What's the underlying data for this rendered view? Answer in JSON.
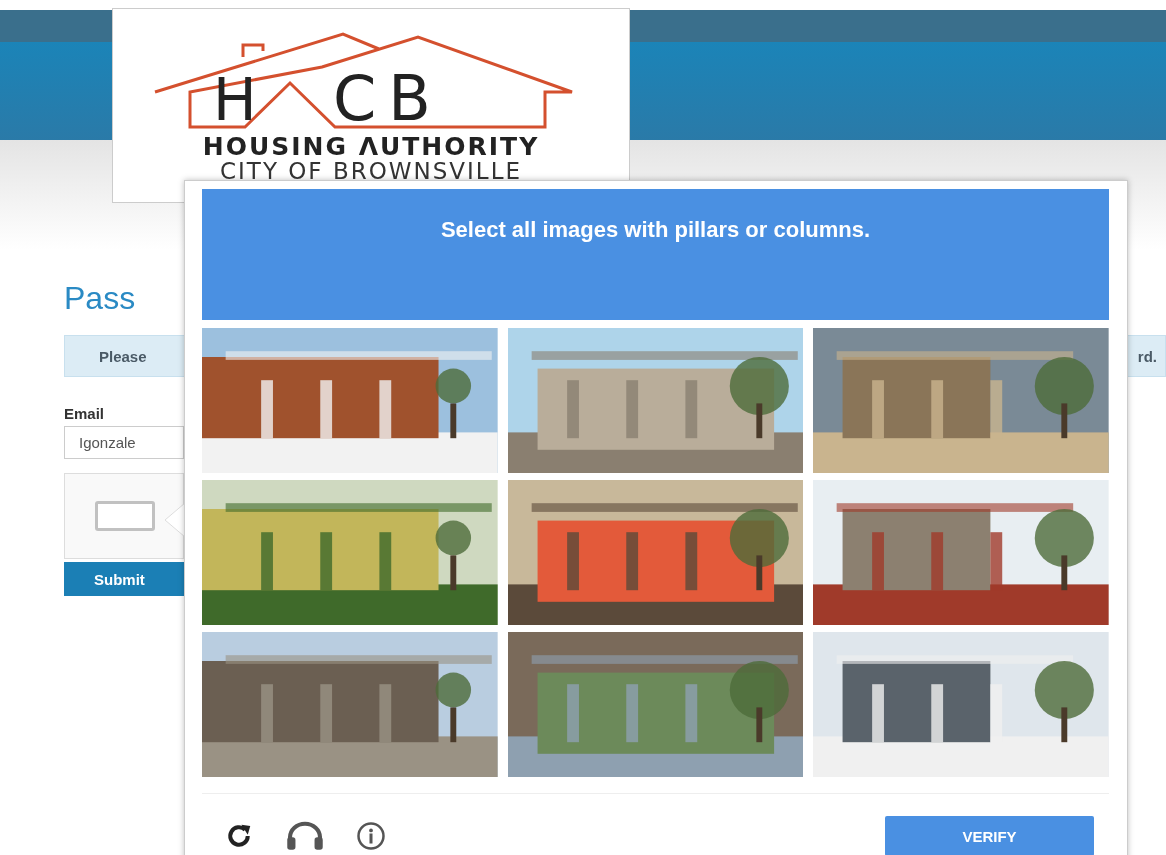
{
  "logo": {
    "letters_left": "H",
    "letters_right": "CB",
    "line_1": "HOUSING ΛUTHORITY",
    "line_2": "CITY OF BROWNSVILLE"
  },
  "page": {
    "title": "Pass",
    "captcha_checked": false,
    "alert_left": "Please",
    "alert_right": "rd.",
    "email_label": "Email",
    "email_value": "Igonzale",
    "submit": "Submit"
  },
  "captcha": {
    "instruction": "Select all images with **pillars or columns**.",
    "verify": "VERIFY"
  }
}
